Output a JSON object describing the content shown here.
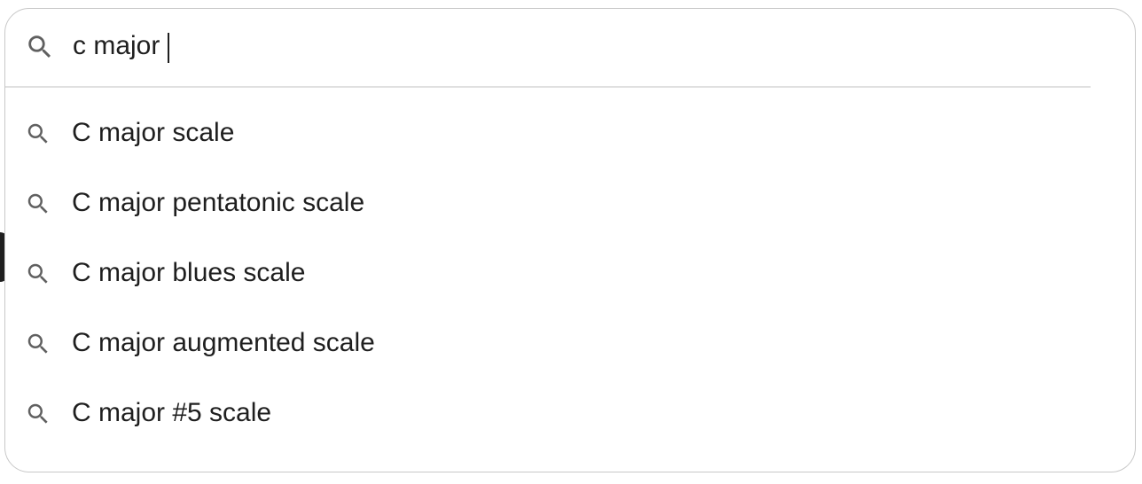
{
  "search": {
    "query": "c major",
    "icon": "search-icon"
  },
  "suggestions": [
    {
      "label": "C major scale",
      "icon": "search-icon"
    },
    {
      "label": "C major pentatonic scale",
      "icon": "search-icon"
    },
    {
      "label": "C major blues scale",
      "icon": "search-icon"
    },
    {
      "label": "C major augmented scale",
      "icon": "search-icon"
    },
    {
      "label": "C major #5 scale",
      "icon": "search-icon"
    }
  ],
  "colors": {
    "text": "#1f1f1f",
    "icon": "#606060",
    "border": "#c8c8c8",
    "divider": "#e0e0e0",
    "background": "#ffffff"
  }
}
